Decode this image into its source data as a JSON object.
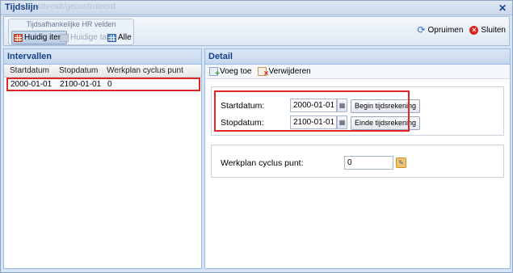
{
  "window": {
    "title": "Tijdslijn",
    "ghost_title": "uitbreidt/gecontroleerd",
    "close_icon": "close-icon"
  },
  "toolbar": {
    "group_title": "Tijdsafhankelijke HR velden",
    "buttons": [
      {
        "label": "Huidig item",
        "icon": "grid-red-icon",
        "state": "active"
      },
      {
        "label": "Huidige tab",
        "icon": "grid-gray-icon",
        "state": "disabled"
      },
      {
        "label": "Alle",
        "icon": "grid-blue-icon",
        "state": "normal"
      }
    ],
    "opruimen_label": "Opruimen",
    "sluiten_label": "Sluiten"
  },
  "intervallen": {
    "title": "Intervallen",
    "columns": [
      "Startdatum",
      "Stopdatum",
      "Werkplan cyclus punt"
    ],
    "rows": [
      [
        "2000-01-01",
        "2100-01-01",
        "0"
      ]
    ]
  },
  "detail": {
    "title": "Detail",
    "add_label": "Voeg toe",
    "delete_label": "Verwijderen",
    "start_label": "Startdatum:",
    "start_value": "2000-01-01",
    "begin_button": "Begin tijdsrekening",
    "stop_label": "Stopdatum:",
    "stop_value": "2100-01-01",
    "end_button": "Einde tijdsrekening",
    "cycle_label": "Werkplan cyclus punt:",
    "cycle_value": "0"
  },
  "colors": {
    "highlight": "#e0262b",
    "header_text": "#15428b",
    "panel_border": "#99bbe8"
  }
}
